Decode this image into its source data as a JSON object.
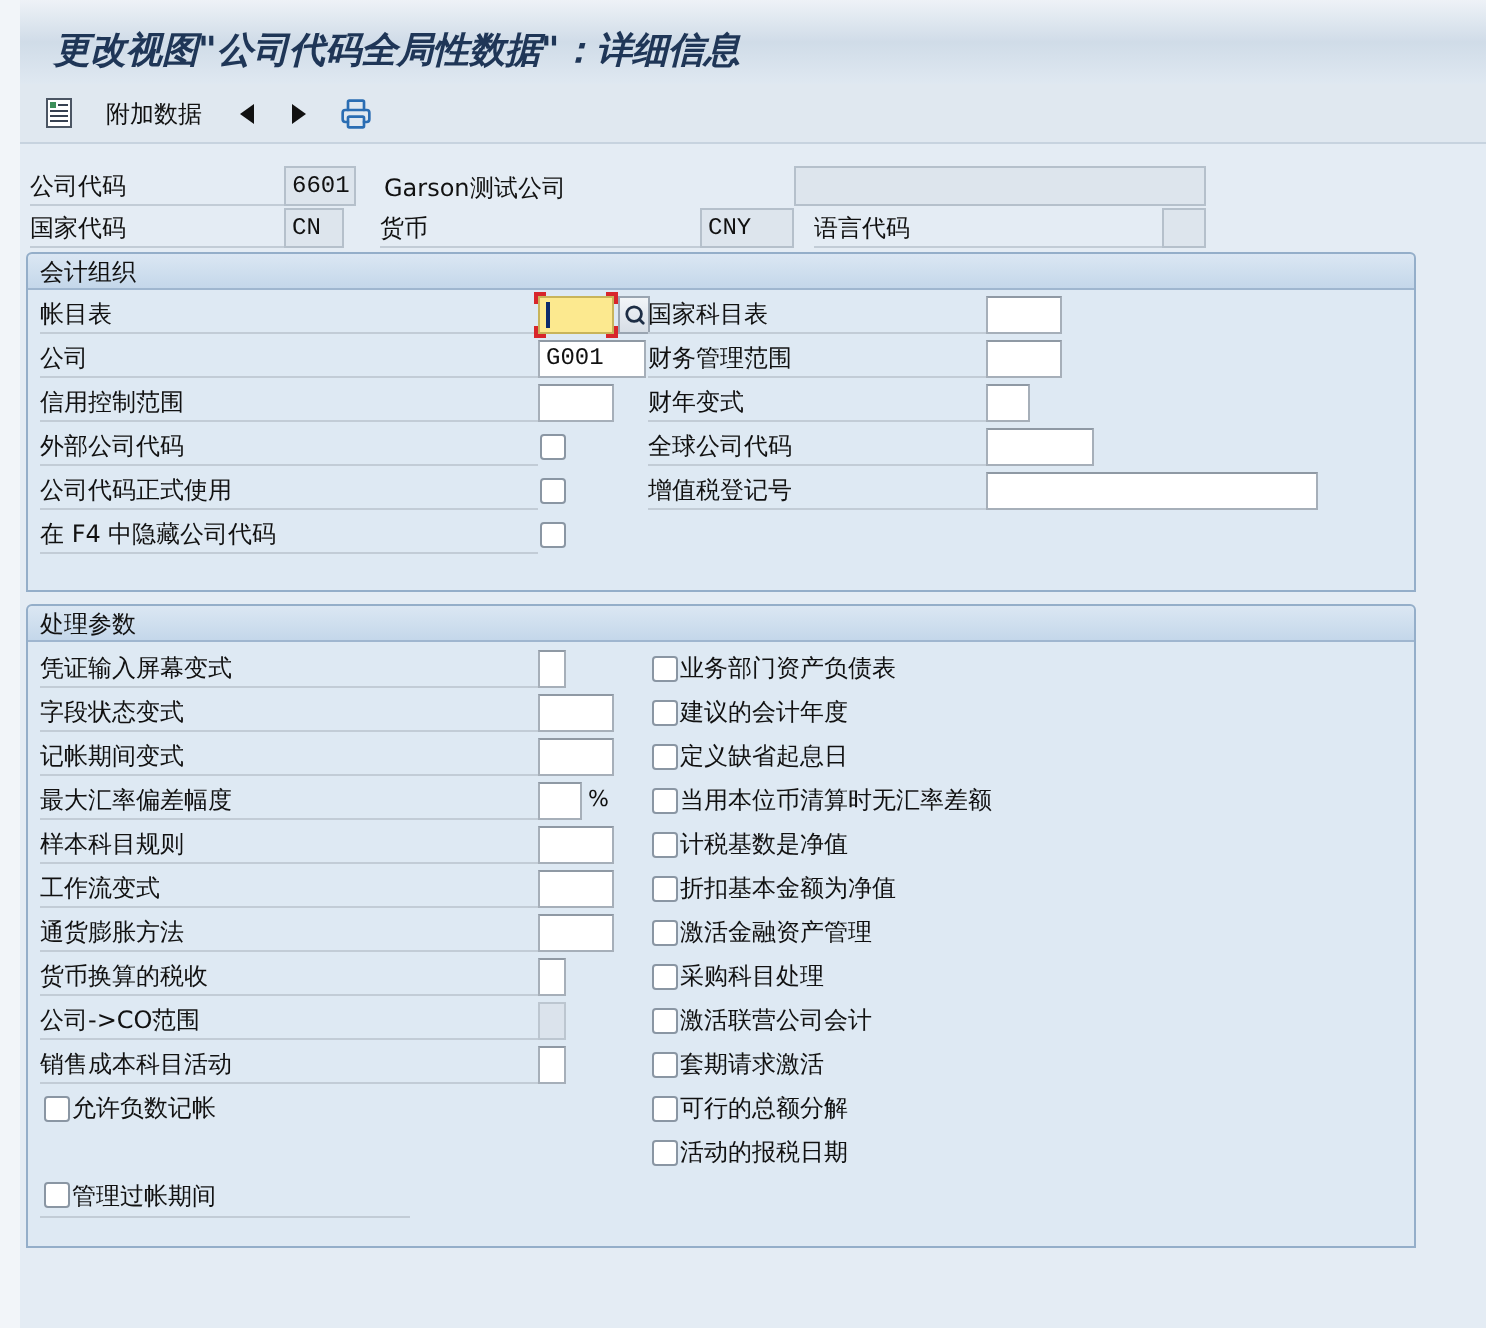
{
  "window": {
    "title": "更改视图\"公司代码全局性数据\"：详细信息"
  },
  "toolbar": [
    {
      "kind": "details"
    },
    {
      "kind": "text",
      "label": "附加数据"
    },
    {
      "kind": "previous"
    },
    {
      "kind": "next"
    },
    {
      "kind": "print"
    }
  ],
  "header": {
    "company_code": {
      "label": "公司代码",
      "value": "6601"
    },
    "company_name": "Garson测试公司",
    "country": {
      "label": "国家代码",
      "value": "CN"
    },
    "currency": {
      "label": "货币",
      "value": "CNY"
    },
    "language": {
      "label": "语言代码"
    }
  },
  "accounting_org": {
    "title": "会计组织",
    "left": [
      {
        "kind": "field",
        "label": "帐目表",
        "focused": true
      },
      {
        "kind": "field",
        "label": "公司",
        "value": "G001",
        "focused": false
      },
      {
        "kind": "field",
        "label": "信用控制范围",
        "focused": false
      },
      {
        "kind": "checkbox",
        "label": "外部公司代码",
        "checked": false
      },
      {
        "kind": "checkbox",
        "label": "公司代码正式使用",
        "checked": false
      },
      {
        "kind": "checkbox",
        "label": "在 F4 中隐藏公司代码",
        "checked": false
      }
    ],
    "right": [
      {
        "label": "国家科目表"
      },
      {
        "label": "财务管理范围"
      },
      {
        "label": "财年变式"
      },
      {
        "label": "全球公司代码"
      },
      {
        "label": "增值税登记号"
      }
    ]
  },
  "processing": {
    "title": "处理参数",
    "left": [
      {
        "kind": "field",
        "label": "凭证输入屏幕变式",
        "disabled": false
      },
      {
        "kind": "field",
        "label": "字段状态变式",
        "disabled": false
      },
      {
        "kind": "field",
        "label": "记帐期间变式",
        "disabled": false
      },
      {
        "kind": "field",
        "label": "最大汇率偏差幅度",
        "unit": "%",
        "disabled": false
      },
      {
        "kind": "field",
        "label": "样本科目规则",
        "disabled": false
      },
      {
        "kind": "field",
        "label": "工作流变式",
        "disabled": false
      },
      {
        "kind": "field",
        "label": "通货膨胀方法",
        "disabled": false
      },
      {
        "kind": "field",
        "label": "货币换算的税收",
        "disabled": false
      },
      {
        "kind": "field",
        "label": "公司->CO范围",
        "disabled": true
      },
      {
        "kind": "field",
        "label": "销售成本科目活动",
        "disabled": false
      },
      {
        "kind": "checkbox",
        "label": "允许负数记帐",
        "checked": false
      }
    ],
    "right": [
      {
        "label": "业务部门资产负债表",
        "checked": false
      },
      {
        "label": "建议的会计年度",
        "checked": false
      },
      {
        "label": "定义缺省起息日",
        "checked": false
      },
      {
        "label": "当用本位币清算时无汇率差额",
        "checked": false
      },
      {
        "label": "计税基数是净值",
        "checked": false
      },
      {
        "label": "折扣基本金额为净值",
        "checked": false
      },
      {
        "label": "激活金融资产管理",
        "checked": false
      },
      {
        "label": "采购科目处理",
        "checked": false
      },
      {
        "label": "激活联营公司会计",
        "checked": false
      },
      {
        "label": "套期请求激活",
        "checked": false
      },
      {
        "label": "可行的总额分解",
        "checked": false
      },
      {
        "label": "活动的报税日期",
        "checked": false
      }
    ],
    "bottom": [
      {
        "label": "管理过帐期间",
        "checked": false
      }
    ]
  }
}
